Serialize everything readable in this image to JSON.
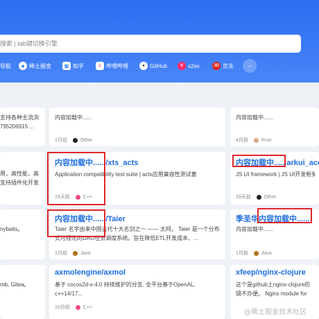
{
  "search": {
    "placeholder": "搜索 | tab键切换引擎"
  },
  "nav": [
    {
      "label": "导航",
      "icon": "nav-icon",
      "color": "#ffffff"
    },
    {
      "label": "稀土掘金",
      "icon": "juejin-icon",
      "color": "#1e80ff"
    },
    {
      "label": "知乎",
      "icon": "zhihu-icon",
      "color": "#0066ff"
    },
    {
      "label": "哔哩哔哩",
      "icon": "bilibili-icon",
      "color": "#fb7299"
    },
    {
      "label": "GitHub",
      "icon": "github-icon",
      "color": "#24292e"
    },
    {
      "label": "v2ex",
      "icon": "v2ex-icon",
      "color": "#ff2b6e"
    },
    {
      "label": "京东",
      "icon": "jd-icon",
      "color": "#e1251b"
    }
  ],
  "more_label": "···",
  "cards": {
    "r1c1": {
      "desc": "支持各种主流浏\n795206915 ...",
      "age": "",
      "lang": "",
      "lang_color": ""
    },
    "r1c2": {
      "desc": "内容加载中......",
      "age": "1月前",
      "lang": "Other",
      "lang_color": "#222222"
    },
    "r1c3": {
      "desc": "内容加载中......",
      "age": "4月前",
      "lang": "Rust",
      "lang_color": "#dea584"
    },
    "r2c1": {
      "desc": "用，高性能，高\n支持插件化开发",
      "age": "",
      "lang": "",
      "lang_color": ""
    },
    "r2c2": {
      "title": "内容加载中....../xts_acts",
      "desc": "Application compatibility test suite | acts应用兼容性测试套",
      "age": "29天前",
      "lang": "C++",
      "lang_color": "#f34b7d"
    },
    "r2c3": {
      "title": "内容加载中......arkui_ace",
      "desc": "JS UI framework | JS UI开发框架",
      "age": "29天前",
      "lang": "Other",
      "lang_color": "#222222"
    },
    "r3c1": {
      "desc": "nybatis。",
      "age": "",
      "lang": "",
      "lang_color": ""
    },
    "r3c2": {
      "title": "内容加载中....../Taier",
      "desc": "Taier 名字由来中国古代十大名剑之一 —— 太阿。 Taier 是一个分布式可视化的DAG任务调度系统。旨在降低ETL开发成本、...",
      "age": "1月前",
      "lang": "Java",
      "lang_color": "#b07219"
    },
    "r3c3": {
      "title": "季圣华内容加载中......",
      "desc": "内容加载中......",
      "age": "1月前",
      "lang": "Java",
      "lang_color": "#b07219"
    },
    "r4c1": {
      "desc": "mb, Gitea。",
      "age": "",
      "lang": "",
      "lang_color": ""
    },
    "r4c2": {
      "title": "axmolengine/axmol",
      "desc": "基于 cocos2d-x-4.0 持续维护的分支, 全平台基于OpenAL, c++14/17...",
      "age": "10月前",
      "lang": "C++",
      "lang_color": "#f34b7d"
    },
    "r4c3": {
      "title": "xfeep/nginx-clojure",
      "desc": "这个是github上nginx-clojure的镜不办便。 Nginx module for embe",
      "age": "",
      "lang": "",
      "lang_color": ""
    }
  },
  "watermark": "@稀土掘金技术社区"
}
